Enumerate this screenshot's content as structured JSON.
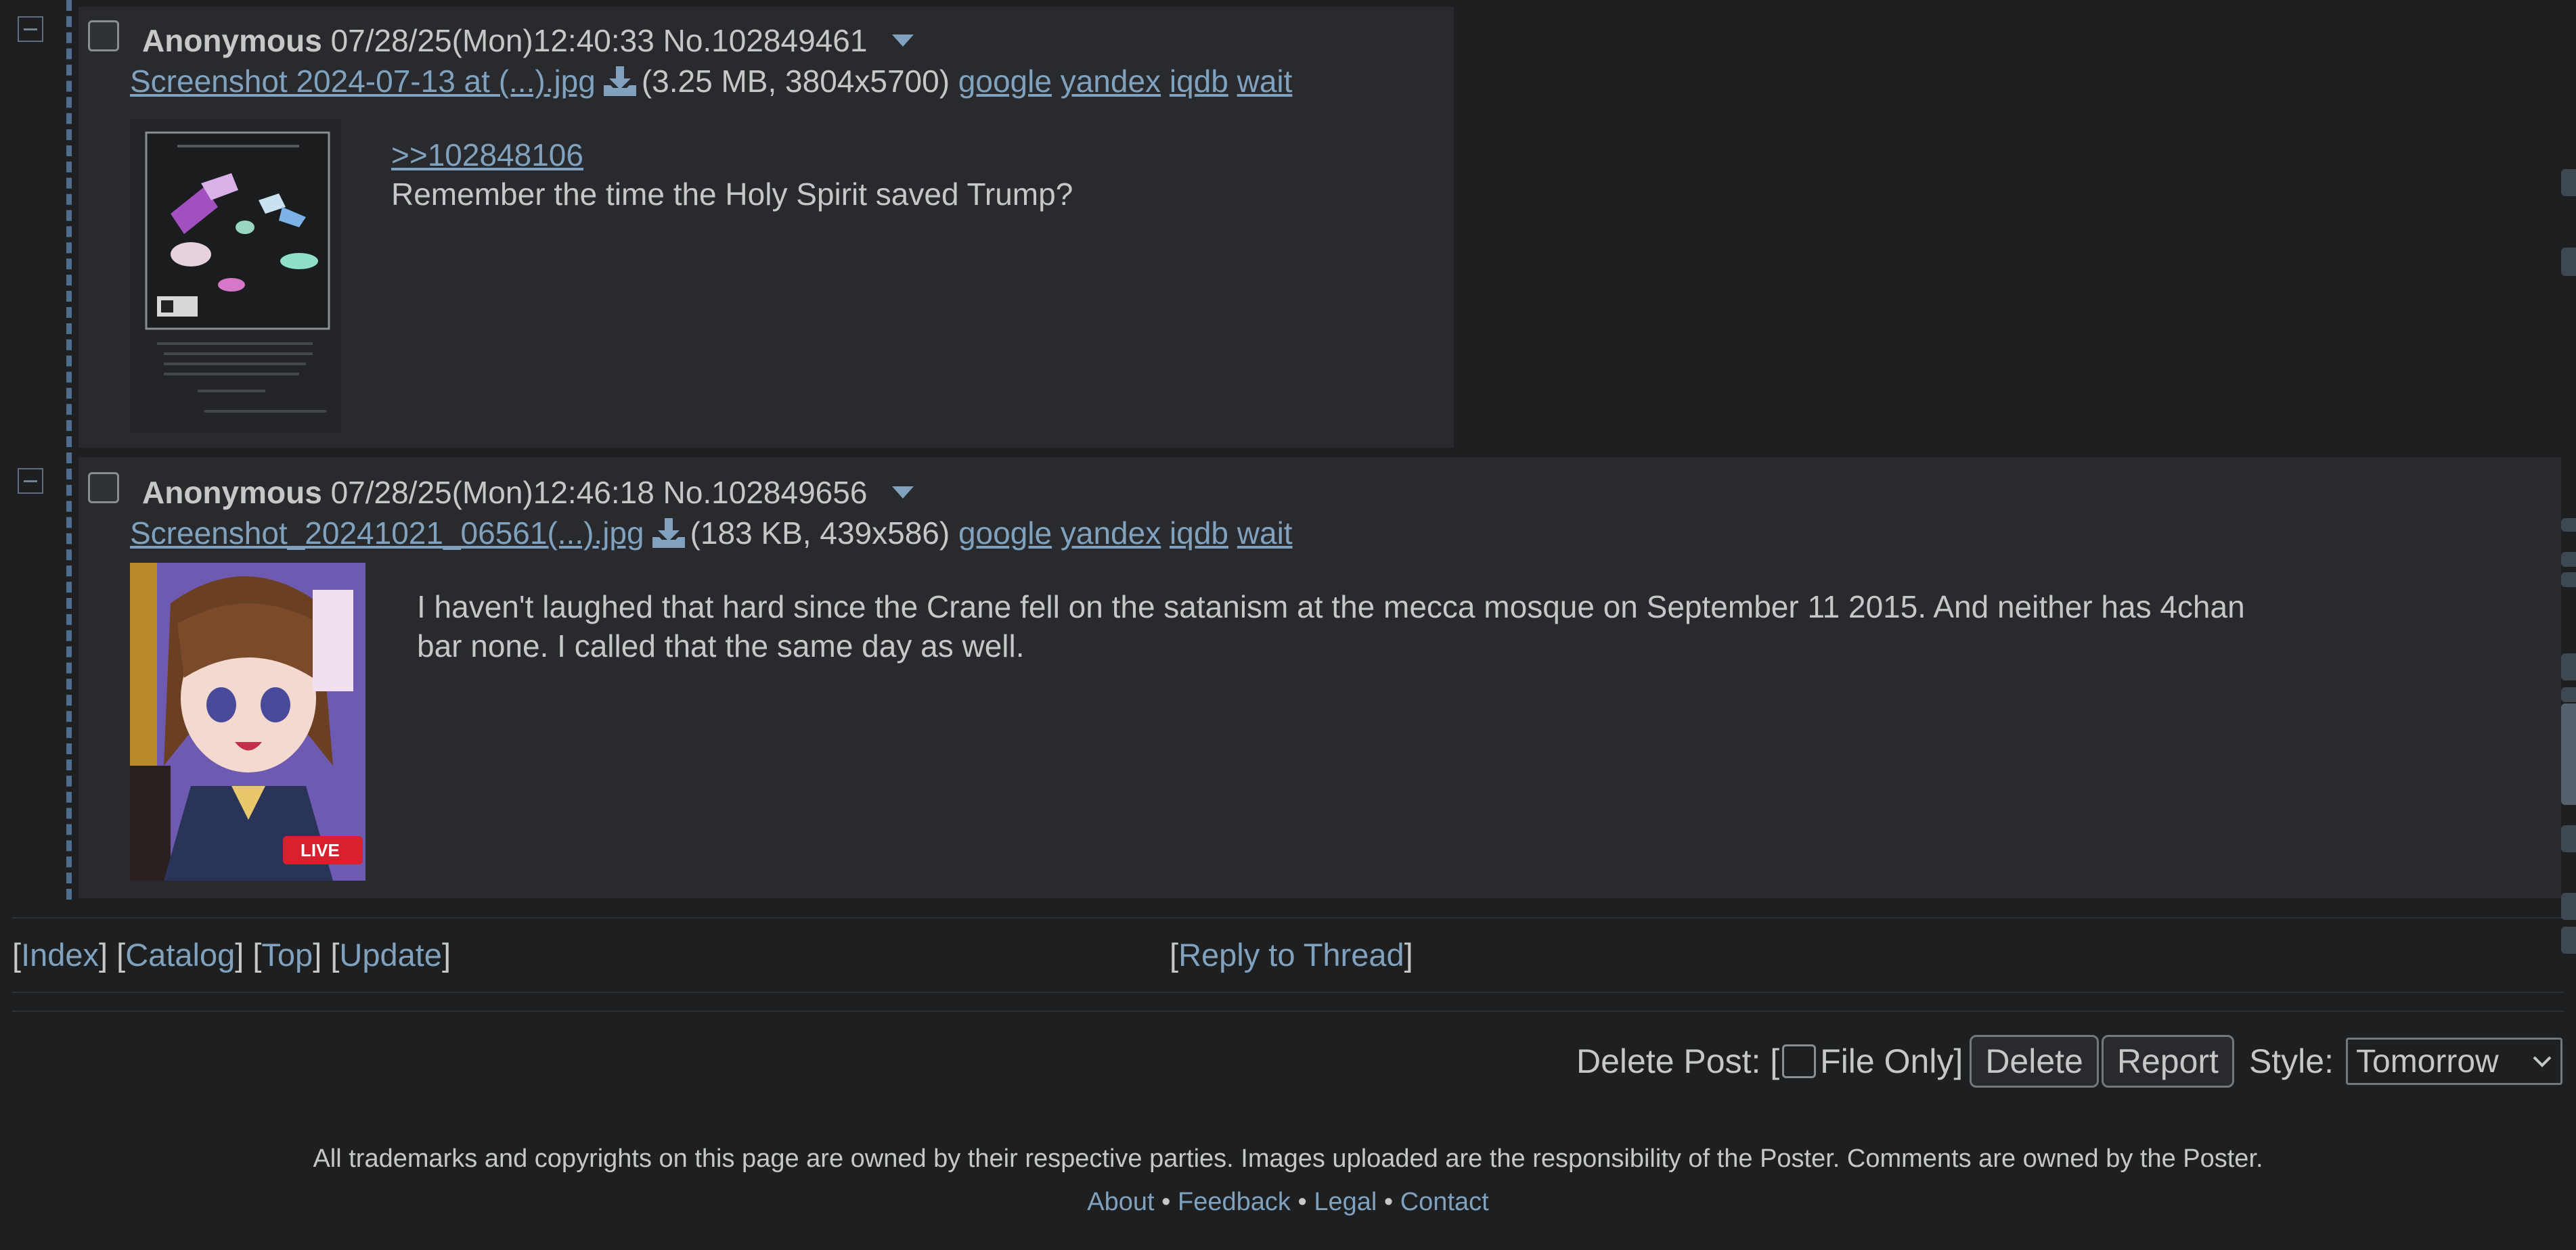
{
  "posts": [
    {
      "name": "Anonymous",
      "datetime": "07/28/25(Mon)12:40:33",
      "number": "No.102849461",
      "file_name": "Screenshot 2024-07-13 at (...).jpg",
      "file_info": "(3.25 MB, 3804x5700)",
      "search_links": [
        "google",
        "yandex",
        "iqdb",
        "wait"
      ],
      "quote_link": ">>102848106",
      "comment": "Remember the time the Holy Spirit saved Trump?"
    },
    {
      "name": "Anonymous",
      "datetime": "07/28/25(Mon)12:46:18",
      "number": "No.102849656",
      "file_name": "Screenshot_20241021_06561(...).jpg",
      "file_info": "(183 KB, 439x586)",
      "search_links": [
        "google",
        "yandex",
        "iqdb",
        "wait"
      ],
      "comment_line1": "I haven't laughed that hard since the Crane fell on the satanism at the mecca mosque on September 11 2015. And neither has 4chan",
      "comment_line2": "bar none. I called that the same day as well.",
      "thumb_badge": "LIVE"
    }
  ],
  "nav": {
    "index": "Index",
    "catalog": "Catalog",
    "top": "Top",
    "update": "Update",
    "reply": "Reply to Thread"
  },
  "delete_row": {
    "label": "Delete Post: [",
    "file_only": "File Only]",
    "delete_button": "Delete",
    "report_button": "Report",
    "style_label": "Style:",
    "style_value": "Tomorrow"
  },
  "footer": {
    "notice": "All trademarks and copyrights on this page are owned by their respective parties. Images uploaded are the responsibility of the Poster. Comments are owned by the Poster.",
    "links": [
      "About",
      "Feedback",
      "Legal",
      "Contact"
    ]
  },
  "colors": {
    "background": "#1d1f21",
    "post_background": "#282a2e",
    "text": "#c5c8c6",
    "link": "#81a2be"
  }
}
